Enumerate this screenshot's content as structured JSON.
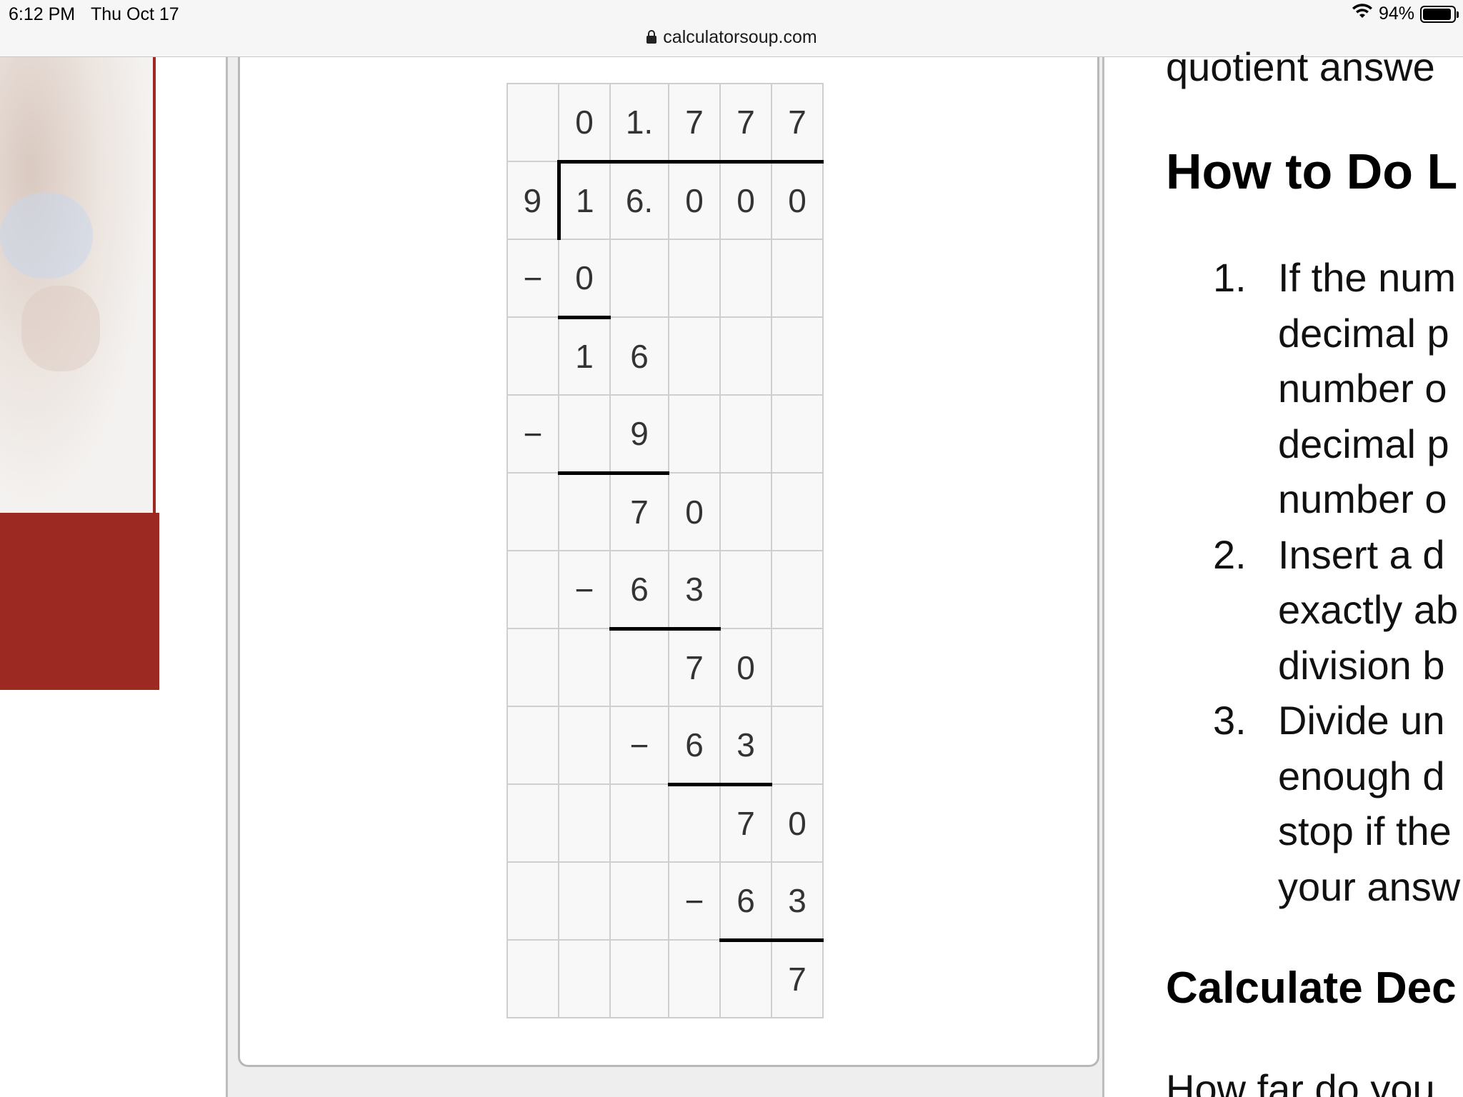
{
  "status_bar": {
    "time": "6:12 PM",
    "date": "Thu Oct 17",
    "battery": "94%",
    "battery_level": 0.94
  },
  "address_bar": {
    "url": "calculatorsoup.com",
    "lock_icon": "lock-icon"
  },
  "colors": {
    "brand_red": "#9c2a22",
    "grid_border": "#cfcfcf",
    "cell_bg": "#f8f8f8"
  },
  "division": {
    "rows": [
      [
        "",
        "0",
        "1.",
        "7",
        "7",
        "7"
      ],
      [
        "9",
        "1",
        "6.",
        "0",
        "0",
        "0"
      ],
      [
        "−",
        "0",
        "",
        "",
        "",
        ""
      ],
      [
        "",
        "1",
        "6",
        "",
        "",
        ""
      ],
      [
        "−",
        "",
        "9",
        "",
        "",
        ""
      ],
      [
        "",
        "",
        "7",
        "0",
        "",
        ""
      ],
      [
        "",
        "−",
        "6",
        "3",
        "",
        ""
      ],
      [
        "",
        "",
        "",
        "7",
        "0",
        ""
      ],
      [
        "",
        "",
        "−",
        "6",
        "3",
        ""
      ],
      [
        "",
        "",
        "",
        "",
        "7",
        "0"
      ],
      [
        "",
        "",
        "",
        "−",
        "6",
        "3"
      ],
      [
        "",
        "",
        "",
        "",
        "",
        "7"
      ]
    ]
  },
  "article": {
    "top_text": "quotient answe",
    "heading": "How to Do L",
    "steps": [
      {
        "number": "1.",
        "lines": [
          "If the num",
          "decimal p",
          "number o",
          "decimal p",
          "number o"
        ]
      },
      {
        "number": "2.",
        "lines": [
          "Insert a d",
          "exactly ab",
          "division b"
        ]
      },
      {
        "number": "3.",
        "lines": [
          "Divide un",
          "enough d",
          "stop if the",
          "your answ"
        ]
      }
    ],
    "subheading": "Calculate Dec",
    "bottom_text": "How far do you"
  }
}
